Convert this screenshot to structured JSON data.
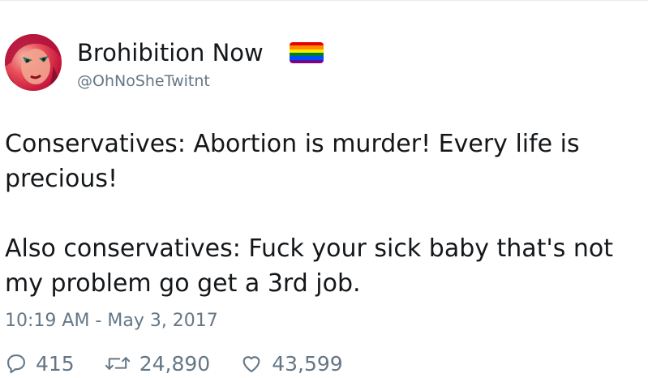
{
  "user": {
    "display_name": "Brohibition Now",
    "handle": "@OhNoSheTwitnt",
    "flag_icon": "rainbow-flag-icon",
    "flag_colors": [
      "#e40303",
      "#ff8c00",
      "#ffed00",
      "#008026",
      "#004dff",
      "#750787"
    ]
  },
  "tweet": {
    "paragraphs": [
      "Conservatives: Abortion is murder! Every life is precious!",
      "Also conservatives: Fuck your sick baby that's not my problem go get a 3rd job."
    ],
    "timestamp": "10:19 AM - May 3, 2017"
  },
  "actions": {
    "reply_icon": "reply-icon",
    "reply_count": "415",
    "retweet_icon": "retweet-icon",
    "retweet_count": "24,890",
    "like_icon": "heart-icon",
    "like_count": "43,599"
  },
  "colors": {
    "text": "#14171a",
    "muted": "#657786"
  }
}
